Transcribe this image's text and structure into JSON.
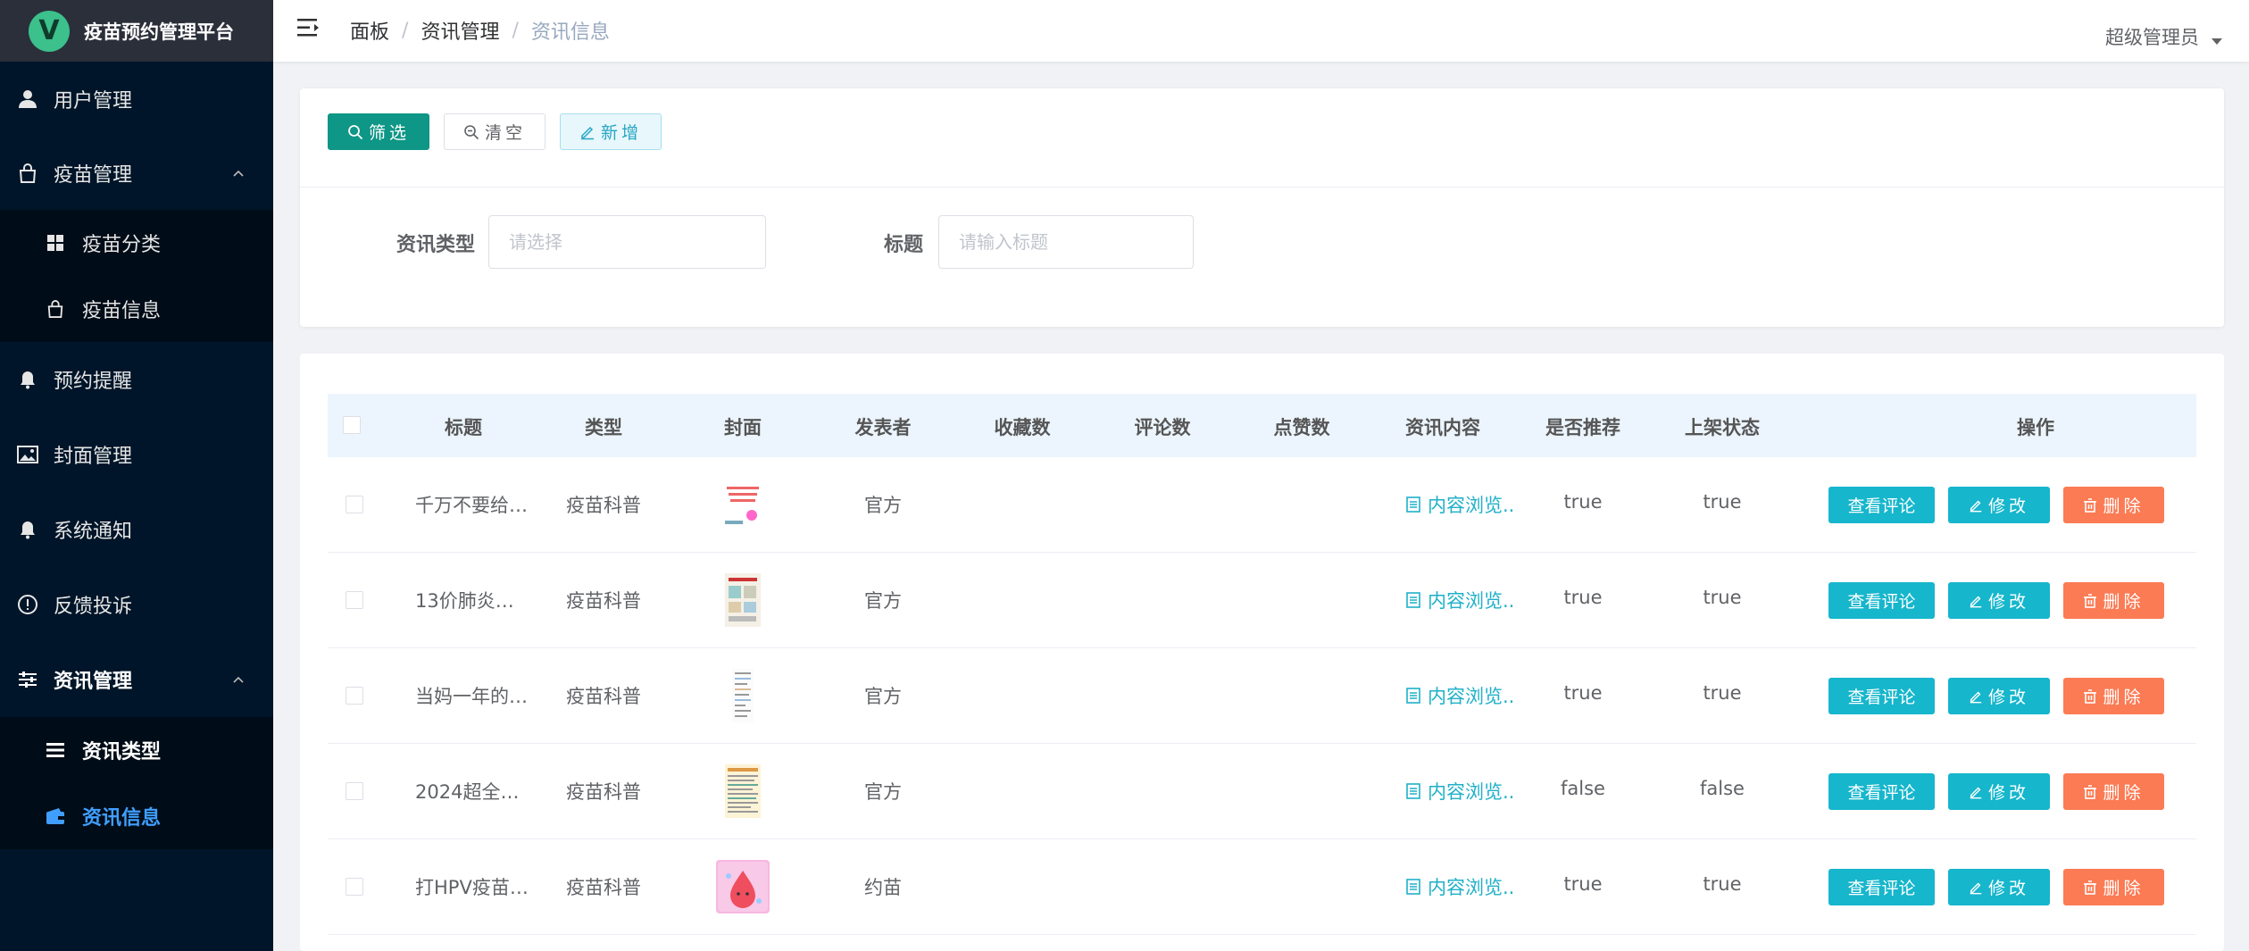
{
  "app": {
    "logo_letter": "V",
    "title": "疫苗预约管理平台"
  },
  "sidebar": {
    "items": [
      {
        "label": "用户管理"
      },
      {
        "label": "疫苗管理",
        "children": [
          {
            "label": "疫苗分类"
          },
          {
            "label": "疫苗信息"
          }
        ]
      },
      {
        "label": "预约提醒"
      },
      {
        "label": "封面管理"
      },
      {
        "label": "系统通知"
      },
      {
        "label": "反馈投诉"
      },
      {
        "label": "资讯管理",
        "children": [
          {
            "label": "资讯类型"
          },
          {
            "label": "资讯信息"
          }
        ]
      }
    ]
  },
  "header": {
    "breadcrumb": [
      "面板",
      "资讯管理",
      "资讯信息"
    ],
    "separator": "/",
    "user": "超级管理员"
  },
  "filter": {
    "buttons": {
      "filter": "筛选",
      "clear": "清空",
      "add": "新增"
    },
    "type_label": "资讯类型",
    "type_placeholder": "请选择",
    "title_label": "标题",
    "title_placeholder": "请输入标题"
  },
  "table": {
    "headers": [
      "标题",
      "类型",
      "封面",
      "发表者",
      "收藏数",
      "评论数",
      "点赞数",
      "资讯内容",
      "是否推荐",
      "上架状态",
      "操作"
    ],
    "content_link": "内容浏览..",
    "actions": {
      "view": "查看评论",
      "edit": "修改",
      "delete": "删除"
    },
    "rows": [
      {
        "title": "千万不要给…",
        "type": "疫苗科普",
        "author": "官方",
        "favorites": "",
        "comments": "",
        "likes": "",
        "recommended": "true",
        "listed": "true"
      },
      {
        "title": "13价肺炎…",
        "type": "疫苗科普",
        "author": "官方",
        "favorites": "",
        "comments": "",
        "likes": "",
        "recommended": "true",
        "listed": "true"
      },
      {
        "title": "当妈一年的…",
        "type": "疫苗科普",
        "author": "官方",
        "favorites": "",
        "comments": "",
        "likes": "",
        "recommended": "true",
        "listed": "true"
      },
      {
        "title": "2024超全…",
        "type": "疫苗科普",
        "author": "官方",
        "favorites": "",
        "comments": "",
        "likes": "",
        "recommended": "false",
        "listed": "false"
      },
      {
        "title": "打HPV疫苗…",
        "type": "疫苗科普",
        "author": "约苗",
        "favorites": "",
        "comments": "",
        "likes": "",
        "recommended": "true",
        "listed": "true"
      }
    ]
  },
  "colors": {
    "sidebar_bg": "#001529",
    "accent_teal": "#16b6cc",
    "delete_orange": "#fb7b54",
    "active_blue": "#409eff"
  }
}
